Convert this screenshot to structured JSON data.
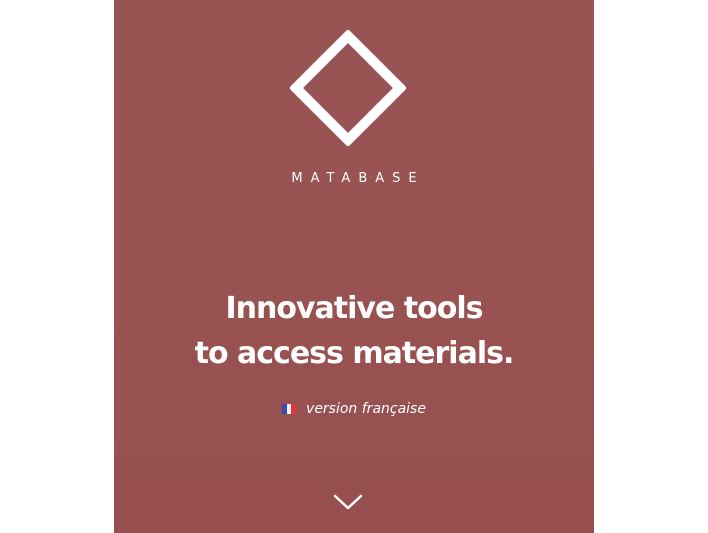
{
  "brand": {
    "name": "MATABASE",
    "logo_icon": "diamond-outline-icon"
  },
  "hero": {
    "headline_line1": "Innovative tools",
    "headline_line2": "to access materials.",
    "background_color": "#985453"
  },
  "language_link": {
    "label": "version française",
    "flag_icon": "french-flag-icon"
  },
  "scroll": {
    "icon": "chevron-down-icon"
  }
}
